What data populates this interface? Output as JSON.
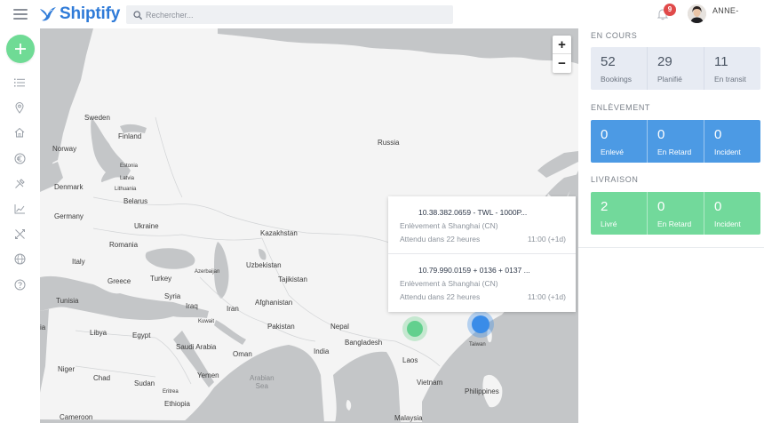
{
  "header": {
    "brand": "Shiptify",
    "search_placeholder": "Rechercher...",
    "notification_count": "9",
    "user_name": "ANNE-"
  },
  "colors": {
    "brand": "#2f7bd8",
    "accent_green": "#6fdb95",
    "blue": "#4c9ae4",
    "green": "#72d99b",
    "badge": "#e04a4a"
  },
  "sidebar": {
    "items": [
      "list-icon",
      "location-pin-icon",
      "home-icon",
      "euro-icon",
      "tools-icon",
      "chart-icon",
      "cross-arrows-icon",
      "globe-icon",
      "help-icon"
    ]
  },
  "map": {
    "zoom_in": "+",
    "zoom_out": "−",
    "labels": {
      "sweden": "Sweden",
      "finland": "Finland",
      "norway": "Norway",
      "estonia": "Estonia",
      "latvia": "Latvia",
      "lithuania": "Lithuania",
      "denmark": "Denmark",
      "belarus": "Belarus",
      "germany": "Germany",
      "ukraine": "Ukraine",
      "russia": "Russia",
      "kazakhstan": "Kazakhstan",
      "romania": "Romania",
      "italy": "Italy",
      "greece": "Greece",
      "turkey": "Turkey",
      "uzbekistan": "Uzbekistan",
      "azerbaijan": "Azerbaijan",
      "tajikistan": "Tajikistan",
      "tunisia": "Tunisia",
      "syria": "Syria",
      "iraq": "Iraq",
      "iran": "Iran",
      "afghanistan": "Afghanistan",
      "kuwait": "Kuwait",
      "libya": "Libya",
      "egypt": "Egypt",
      "pakistan": "Pakistan",
      "nepal": "Nepal",
      "saudi": "Saudi Arabia",
      "oman": "Oman",
      "india": "India",
      "bangladesh": "Bangladesh",
      "laos": "Laos",
      "vietnam": "Vietnam",
      "taiwan": "Taiwan",
      "philippines": "Philippines",
      "niger": "Niger",
      "chad": "Chad",
      "sudan": "Sudan",
      "yemen": "Yemen",
      "eritrea": "Eritrea",
      "ethiopia": "Ethiopia",
      "arabian_sea": "Arabian\nSea",
      "cameroon": "Cameroon",
      "malaysia": "Malaysia",
      "algeria": "ia"
    },
    "popup": [
      {
        "title": "10.38.382.0659 - TWL - 1000P...",
        "subtitle": "Enlèvement à Shanghai (CN)",
        "eta": "Attendu dans 22 heures",
        "time": "11:00 (+1d)"
      },
      {
        "title": "10.79.990.0159 + 0136 + 0137 ...",
        "subtitle": "Enlèvement à Shanghai (CN)",
        "eta": "Attendu dans 22 heures",
        "time": "11:00 (+1d)"
      }
    ]
  },
  "panel": {
    "en_cours": {
      "title": "EN COURS",
      "stats": [
        {
          "value": "52",
          "label": "Bookings"
        },
        {
          "value": "29",
          "label": "Planifié"
        },
        {
          "value": "11",
          "label": "En transit"
        }
      ]
    },
    "enlevement": {
      "title": "ENLÈVEMENT",
      "stats": [
        {
          "value": "0",
          "label": "Enlevé"
        },
        {
          "value": "0",
          "label": "En Retard"
        },
        {
          "value": "0",
          "label": "Incident"
        }
      ]
    },
    "livraison": {
      "title": "LIVRAISON",
      "stats": [
        {
          "value": "2",
          "label": "Livré"
        },
        {
          "value": "0",
          "label": "En Retard"
        },
        {
          "value": "0",
          "label": "Incident"
        }
      ]
    }
  }
}
